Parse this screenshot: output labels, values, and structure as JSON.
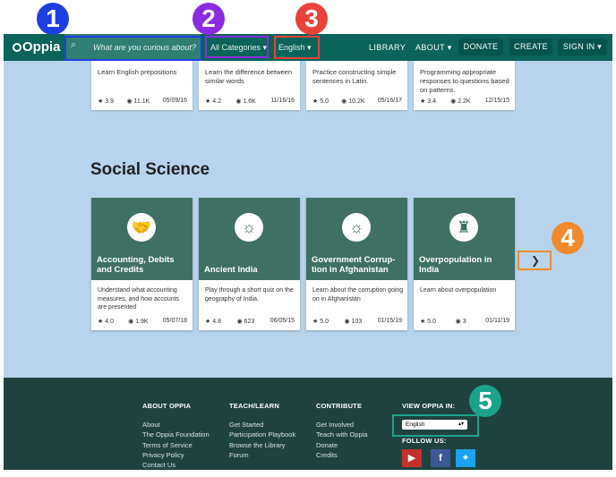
{
  "navbar": {
    "logo": "Oppia",
    "search_placeholder": "What are you curious about?",
    "categories": "All Categories",
    "language": "English",
    "library": "LIBRARY",
    "about": "ABOUT",
    "donate": "DONATE",
    "create": "CREATE",
    "sign_in": "SIGN IN"
  },
  "top_cards": [
    {
      "desc": "Learn English prepositions",
      "rating": "3.9",
      "views": "11.1K",
      "date": "05/09/16"
    },
    {
      "desc": "Learn the difference between similar words",
      "rating": "4.2",
      "views": "1.6K",
      "date": "11/16/16"
    },
    {
      "desc": "Practice constructing simple sentences in Latin.",
      "rating": "5.0",
      "views": "10.2K",
      "date": "05/16/17"
    },
    {
      "desc": "Programming appropriate responses to questions based on patterns.",
      "rating": "3.4",
      "views": "2.2K",
      "date": "12/15/15"
    }
  ],
  "section_title": "Social Science",
  "cards": [
    {
      "title": "Accounting, Debits and Credits",
      "desc": "Understand what accounting measures, and how accounts are presented",
      "rating": "4.0",
      "views": "1.9K",
      "date": "05/07/18",
      "icon": "handshake-icon"
    },
    {
      "title": "Ancient India",
      "desc": "Play through a short quiz on the geography of India.",
      "rating": "4.8",
      "views": "623",
      "date": "06/05/15",
      "icon": "compass-icon"
    },
    {
      "title": "Government Corrup-tion in Afghanistan",
      "desc": "Learn about the corruption going on in Afghanistan",
      "rating": "5.0",
      "views": "103",
      "date": "01/15/19",
      "icon": "compass-icon"
    },
    {
      "title": "Overpopulation in India",
      "desc": "Learn about overpopulation",
      "rating": "5.0",
      "views": "3",
      "date": "01/11/19",
      "icon": "knight-helmet-icon"
    }
  ],
  "footer": {
    "about_heading": "ABOUT OPPIA",
    "about_links": [
      "About",
      "The Oppia Foundation",
      "Terms of Service",
      "Privacy Policy",
      "Contact Us"
    ],
    "teach_heading": "TEACH/LEARN",
    "teach_links": [
      "Get Started",
      "Participation Playbook",
      "Browse the Library",
      "Forum"
    ],
    "contribute_heading": "CONTRIBUTE",
    "contribute_links": [
      "Get Involved",
      "Teach with Oppia",
      "Donate",
      "Credits"
    ],
    "view_in_heading": "VIEW OPPIA IN:",
    "view_in_value": "English",
    "follow_heading": "FOLLOW US:"
  },
  "annotations": [
    "1",
    "2",
    "3",
    "4",
    "5"
  ],
  "colors": {
    "navbar": "#0b6359",
    "page_bg": "#b8d4ec",
    "card_thumb": "#3e7163",
    "footer": "#1f423f",
    "ann1": "#1e3fe0",
    "ann2": "#8a2be2",
    "ann3": "#e8423a",
    "ann4": "#f08a2c",
    "ann5": "#1aa38a"
  }
}
